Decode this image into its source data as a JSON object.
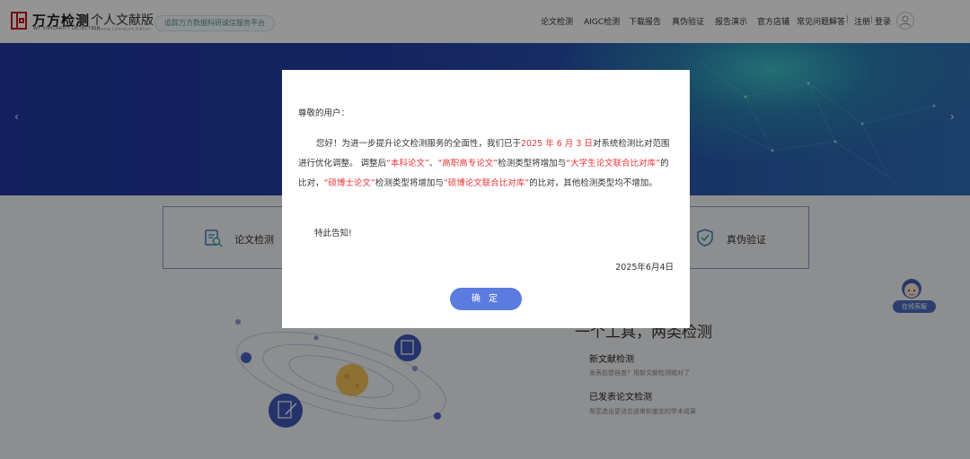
{
  "header": {
    "brand_name": "万方检测",
    "brand_en": "WF SIMILARITY DETECTION",
    "edition": "个人文献版",
    "edition_en": "Personal Literature Edition",
    "slogan": "追踪万方数据科研诚信服务平台",
    "nav": [
      "论文检测",
      "AIGC检测",
      "下载报告",
      "真伪验证",
      "报告演示",
      "官方店铺",
      "常见问题解答"
    ],
    "register": "注册",
    "separator": "|",
    "login": "登录"
  },
  "banner": {
    "prev_arrow": "‹",
    "next_arrow": "›"
  },
  "cards": {
    "paper_check": "论文检测",
    "authenticity": "真伪验证"
  },
  "main": {
    "title": "一个工具，两类检测",
    "features": [
      {
        "title": "新文献检测",
        "desc": "发表前想自查？用新文献检测就对了"
      },
      {
        "title": "已发表论文检测",
        "desc": "帮您选出更适合送审和鉴定的学术成果"
      }
    ]
  },
  "customer_service": {
    "label": "在线客服"
  },
  "modal": {
    "greeting": "尊敬的用户：",
    "p1": "您好！为进一步提升论文检测服务的全面性，我们已于",
    "date_hl": "2025 年 6 月 3 日",
    "p2": "对系统检测比对范围进行优化调整。 调整后",
    "t1": "“本科论文”",
    "p3": "、",
    "t2": "“高职高专论文”",
    "p4": "检测类型将增加与",
    "t3": "“大学生论文联合比对库”",
    "p5": "的比对，",
    "t4": "“硕博士论文”",
    "p6": "检测类型将增加与",
    "t5": "“硕博论文联合比对库”",
    "p7": "的比对，其他检测类型均不增加。",
    "notice": "特此告知!",
    "date": "2025年6月4日",
    "confirm": "确 定"
  },
  "colors": {
    "brand_red": "#c8161d",
    "highlight_red": "#e8363a",
    "button_blue": "#5b7be0",
    "banner_blue": "#243fa5"
  }
}
